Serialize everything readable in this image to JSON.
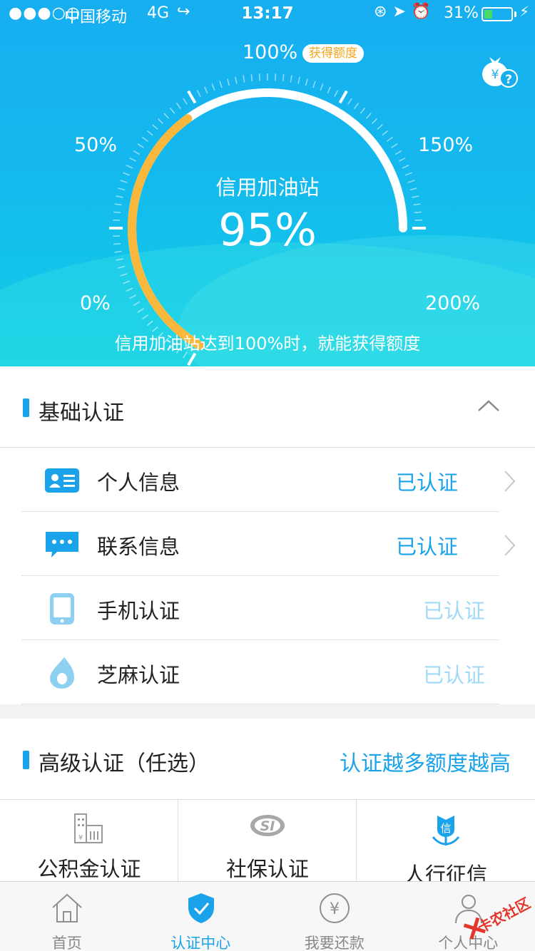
{
  "status_bar": {
    "signal": "●●●○○",
    "carrier": "中国移动",
    "network": "4G",
    "time": "13:17",
    "battery_percent": "31%",
    "battery_level": 0.31
  },
  "gauge": {
    "title": "信用加油站",
    "value": "95%",
    "value_fraction": 0.95,
    "scale_labels": [
      "0%",
      "50%",
      "100%",
      "150%",
      "200%"
    ],
    "badge": "获得额度",
    "hint": "信用加油站达到100%时，就能获得额度",
    "colors": {
      "progress": "#f9b73c",
      "track": "#ffffff"
    }
  },
  "basic": {
    "title": "基础认证",
    "items": [
      {
        "label": "个人信息",
        "status": "已认证",
        "icon": "id-card-icon"
      },
      {
        "label": "联系信息",
        "status": "已认证",
        "icon": "chat-bubble-icon"
      },
      {
        "label": "手机认证",
        "status": "已认证",
        "icon": "phone-icon"
      },
      {
        "label": "芝麻认证",
        "status": "已认证",
        "icon": "sesame-drop-icon"
      }
    ]
  },
  "advanced": {
    "title": "高级认证（任选）",
    "more": "认证越多额度越高",
    "items": [
      {
        "label": "公积金认证",
        "icon": "building-icon"
      },
      {
        "label": "社保认证",
        "icon": "social-insurance-icon"
      },
      {
        "label": "人行征信",
        "icon": "credit-flower-icon"
      }
    ]
  },
  "tabbar": {
    "tabs": [
      {
        "label": "首页",
        "icon": "home-icon"
      },
      {
        "label": "认证中心",
        "icon": "shield-icon"
      },
      {
        "label": "我要还款",
        "icon": "yen-icon"
      },
      {
        "label": "个人中心",
        "icon": "person-icon"
      }
    ],
    "active_index": 1
  },
  "watermark": "卡农社区",
  "colors": {
    "accent": "#1aa3ea",
    "header_top": "#17aef0",
    "header_bottom": "#12cfe6"
  }
}
